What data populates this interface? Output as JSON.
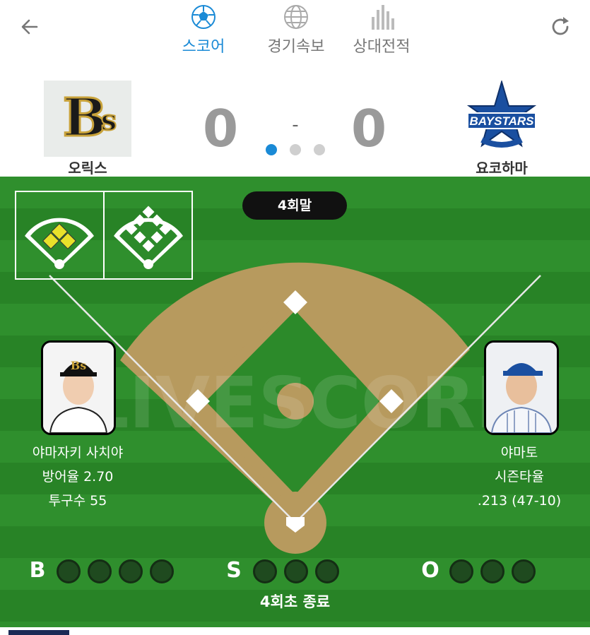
{
  "nav": {
    "tabs": [
      {
        "label": "스코어",
        "icon": "soccer-ball-icon",
        "active": true
      },
      {
        "label": "경기속보",
        "icon": "globe-icon",
        "active": false
      },
      {
        "label": "상대전적",
        "icon": "bar-chart-icon",
        "active": false
      }
    ]
  },
  "match": {
    "home": {
      "name": "오릭스",
      "score": "0",
      "logo": "orix-buffaloes-logo"
    },
    "away": {
      "name": "요코하마",
      "score": "0",
      "logo": "yokohama-baystars-logo"
    },
    "separator": "-",
    "page_dots": 3,
    "active_dot": 0
  },
  "field": {
    "inning": "4회말",
    "watermark": "LIVESCORE",
    "pitcher": {
      "name": "야마자키 사치야",
      "stat1": "방어율 2.70",
      "stat2": "투구수 55"
    },
    "batter": {
      "name": "야마토",
      "stat1": "시즌타율",
      "stat2": ".213 (47-10)"
    },
    "count": {
      "balls": {
        "label": "B",
        "lit": 0,
        "max": 4
      },
      "strikes": {
        "label": "S",
        "lit": 0,
        "max": 3
      },
      "outs": {
        "label": "O",
        "lit": 0,
        "max": 3
      }
    },
    "status_text": "4회초 종료"
  },
  "colors": {
    "accent": "#1a8ad6",
    "field_green": "#2c8a2a",
    "dirt": "#b79a5e",
    "base_highlight": "#e8e12a"
  }
}
